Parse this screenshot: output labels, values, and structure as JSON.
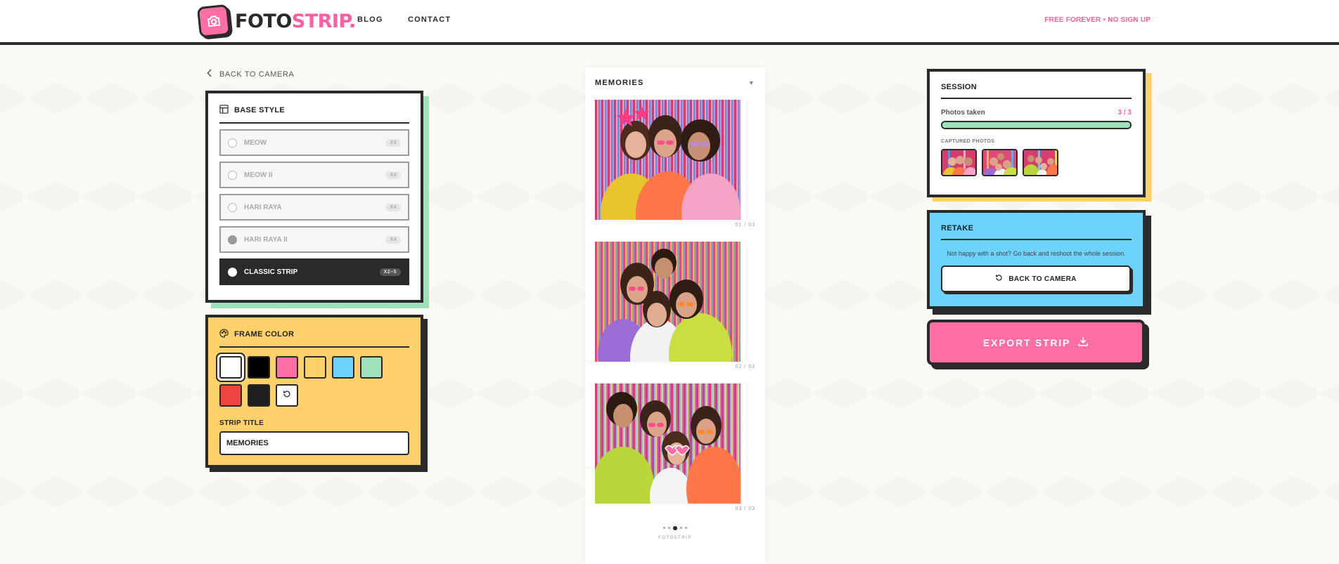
{
  "header": {
    "brand_part1": "FOTO",
    "brand_part2": "STRIP.",
    "nav": [
      "BLOG",
      "CONTACT"
    ],
    "tagline": "FREE FOREVER • NO SIGN UP"
  },
  "back_link": "BACK TO CAMERA",
  "base_style": {
    "title": "BASE STYLE",
    "options": [
      {
        "label": "MEOW",
        "tag": "X3"
      },
      {
        "label": "MEOW II",
        "tag": "X3"
      },
      {
        "label": "HARI RAYA",
        "tag": "X4"
      },
      {
        "label": "HARI RAYA II",
        "tag": "X4"
      },
      {
        "label": "CLASSIC STRIP",
        "tag": "X2–5"
      }
    ],
    "selected": "CLASSIC STRIP"
  },
  "frame_color": {
    "title": "FRAME COLOR",
    "swatches": [
      "#ffffff",
      "#000000",
      "#ff6fa5",
      "#ffd16b",
      "#6dd3fb",
      "#9fe1b8",
      "#ef4444",
      "#1f1f1f"
    ],
    "selected": "#ffffff",
    "reset_icon": "reset-icon",
    "strip_title_label": "STRIP TITLE",
    "strip_title_value": "MEMORIES"
  },
  "strip": {
    "title": "MEMORIES",
    "caret": "▼",
    "photo_numbers": [
      "01  /  03",
      "02  /  03",
      "03  /  03"
    ],
    "footer": "FOTOSTRIP"
  },
  "session": {
    "title": "SESSION",
    "photos_taken_label": "Photos taken",
    "photos_taken_value": "3 / 3",
    "progress": 1.0,
    "captured_label": "CAPTURED PHOTOS"
  },
  "retake": {
    "title": "RETAKE",
    "text": "Not happy with a shot? Go back and reshoot the whole session.",
    "button": "BACK TO CAMERA"
  },
  "export": {
    "label": "EXPORT STRIP"
  },
  "colors": {
    "accent_pink": "#ff6fa5",
    "yellow": "#ffd16b",
    "blue": "#6dd3fb",
    "green": "#9fe1b8",
    "ink": "#2a2a2a"
  }
}
